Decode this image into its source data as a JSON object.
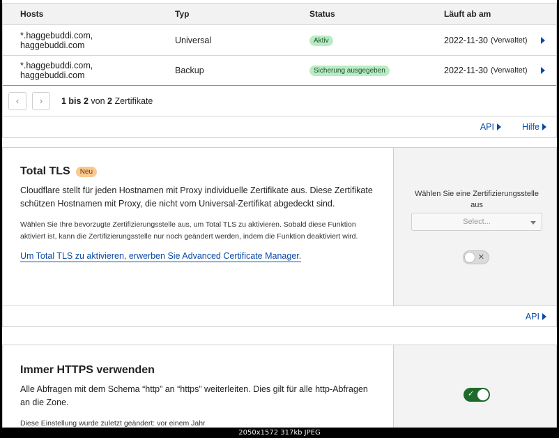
{
  "cert_table": {
    "headers": {
      "hosts": "Hosts",
      "type": "Typ",
      "status": "Status",
      "expires": "Läuft ab am"
    },
    "rows": [
      {
        "hosts": "*.haggebuddi.com, haggebuddi.com",
        "type": "Universal",
        "status": "Aktiv",
        "expires": "2022-11-30",
        "managed": "(Verwaltet)"
      },
      {
        "hosts": "*.haggebuddi.com, haggebuddi.com",
        "type": "Backup",
        "status": "Sicherung ausgegeben",
        "expires": "2022-11-30",
        "managed": "(Verwaltet)"
      }
    ],
    "pagination": {
      "range": "1 bis 2",
      "of": "von",
      "total": "2",
      "unit": "Zertifikate",
      "prev_icon": "chevron-left-icon",
      "next_icon": "chevron-right-icon"
    },
    "footer": {
      "api": "API",
      "help": "Hilfe"
    }
  },
  "total_tls": {
    "title": "Total TLS",
    "badge": "Neu",
    "description": "Cloudflare stellt für jeden Hostnamen mit Proxy individuelle Zertifikate aus. Diese Zertifikate schützen Hostnamen mit Proxy, die nicht vom Universal-Zertifikat abgedeckt sind.",
    "note": "Wählen Sie Ihre bevorzugte Zertifizierungsstelle aus, um Total TLS zu aktivieren. Sobald diese Funktion aktiviert ist, kann die Zertifizierungsstelle nur noch geändert werden, indem die Funktion deaktiviert wird.",
    "link": "Um Total TLS zu aktivieren, erwerben Sie Advanced Certificate Manager.",
    "side_label": "Wählen Sie eine Zertifizierungsstelle aus",
    "select_placeholder": "Select...",
    "toggle_mark": "✕",
    "footer_api": "API"
  },
  "always_https": {
    "title": "Immer HTTPS verwenden",
    "description": "Alle Abfragen mit dem Schema “http” an “https” weiterleiten. Dies gilt für alle http-Abfragen an die Zone.",
    "note": "Diese Einstellung wurde zuletzt geändert: vor einem Jahr",
    "toggle_mark": "✓"
  },
  "caption": "2050x1572 317kb JPEG",
  "colors": {
    "accent_link": "#0a4aa6",
    "badge_green": "#b9ecc4",
    "badge_new": "#f9c98f",
    "toggle_on": "#1e6a2b"
  }
}
